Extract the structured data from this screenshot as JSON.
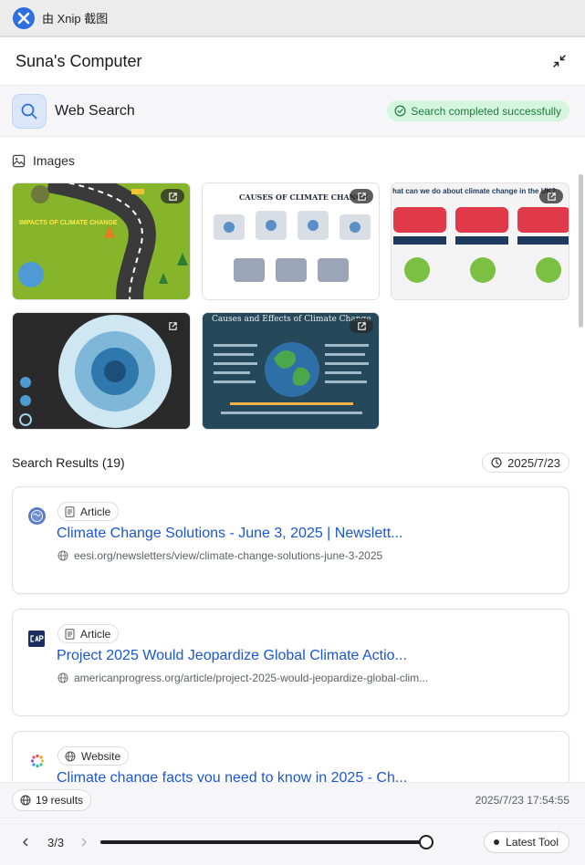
{
  "xnip": {
    "title": "由 Xnip 截图"
  },
  "window": {
    "title": "Suna's Computer"
  },
  "tool": {
    "name": "Web Search",
    "status": "Search completed successfully"
  },
  "images_section": {
    "label": "Images",
    "images": [
      {
        "caption": "IMPACTS OF CLIMATE CHANGE"
      },
      {
        "caption": "CAUSES OF CLIMATE CHANGE"
      },
      {
        "caption": "hat can we do about climate change in the UK?"
      },
      {
        "caption": ""
      },
      {
        "caption": "Causes and Effects of Climate Change"
      }
    ]
  },
  "results": {
    "title": "Search Results (19)",
    "date": "2025/7/23",
    "items": [
      {
        "badge": "Article",
        "title": "Climate Change Solutions - June 3, 2025 | Newslett...",
        "url": "eesi.org/newsletters/view/climate-change-solutions-june-3-2025"
      },
      {
        "badge": "Article",
        "title": "Project 2025 Would Jeopardize Global Climate Actio...",
        "url": "americanprogress.org/article/project-2025-would-jeopardize-global-clim..."
      },
      {
        "badge": "Website",
        "title": "Climate change facts you need to know in 2025 - Ch...",
        "url": ""
      }
    ]
  },
  "footer": {
    "count": "19 results",
    "timestamp": "2025/7/23 17:54:55"
  },
  "navigation": {
    "step": "3/3",
    "progress": 1.0,
    "latest_label": "Latest Tool"
  }
}
